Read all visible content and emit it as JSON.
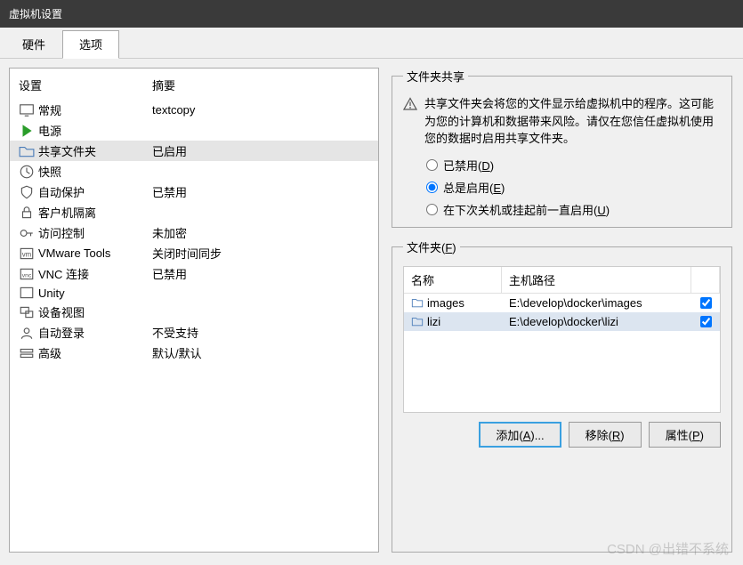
{
  "window": {
    "title": "虚拟机设置"
  },
  "tabs": [
    {
      "label": "硬件",
      "active": false
    },
    {
      "label": "选项",
      "active": true
    }
  ],
  "settings_list": {
    "header": {
      "setting": "设置",
      "summary": "摘要"
    },
    "items": [
      {
        "icon": "monitor",
        "label": "常规",
        "summary": "textcopy"
      },
      {
        "icon": "play",
        "label": "电源",
        "summary": ""
      },
      {
        "icon": "folder-share",
        "label": "共享文件夹",
        "summary": "已启用",
        "selected": true
      },
      {
        "icon": "clock",
        "label": "快照",
        "summary": ""
      },
      {
        "icon": "shield",
        "label": "自动保护",
        "summary": "已禁用"
      },
      {
        "icon": "lock",
        "label": "客户机隔离",
        "summary": ""
      },
      {
        "icon": "key",
        "label": "访问控制",
        "summary": "未加密"
      },
      {
        "icon": "vm",
        "label": "VMware Tools",
        "summary": "关闭时间同步"
      },
      {
        "icon": "vnc",
        "label": "VNC 连接",
        "summary": "已禁用"
      },
      {
        "icon": "unity",
        "label": "Unity",
        "summary": ""
      },
      {
        "icon": "devices",
        "label": "设备视图",
        "summary": ""
      },
      {
        "icon": "autologin",
        "label": "自动登录",
        "summary": "不受支持"
      },
      {
        "icon": "advanced",
        "label": "高级",
        "summary": "默认/默认"
      }
    ]
  },
  "sharing": {
    "legend": "文件夹共享",
    "warning": "共享文件夹会将您的文件显示给虚拟机中的程序。这可能为您的计算机和数据带来风险。请仅在您信任虚拟机使用您的数据时启用共享文件夹。",
    "options": {
      "disabled": {
        "label": "已禁用(",
        "key": "D",
        "suffix": ")"
      },
      "always": {
        "label": "总是启用(",
        "key": "E",
        "suffix": ")"
      },
      "until": {
        "label": "在下次关机或挂起前一直启用(",
        "key": "U",
        "suffix": ")"
      }
    },
    "selected": "always"
  },
  "folders": {
    "legend_pre": "文件夹(",
    "legend_key": "F",
    "legend_suf": ")",
    "columns": {
      "name": "名称",
      "path": "主机路径"
    },
    "rows": [
      {
        "name": "images",
        "path": "E:\\develop\\docker\\images",
        "checked": true
      },
      {
        "name": "lizi",
        "path": "E:\\develop\\docker\\lizi",
        "checked": true,
        "selected": true
      }
    ],
    "buttons": {
      "add": {
        "pre": "添加(",
        "key": "A",
        "suf": ")..."
      },
      "remove": {
        "pre": "移除(",
        "key": "R",
        "suf": ")"
      },
      "props": {
        "pre": "属性(",
        "key": "P",
        "suf": ")"
      }
    }
  },
  "watermark": "CSDN @出错不系统"
}
